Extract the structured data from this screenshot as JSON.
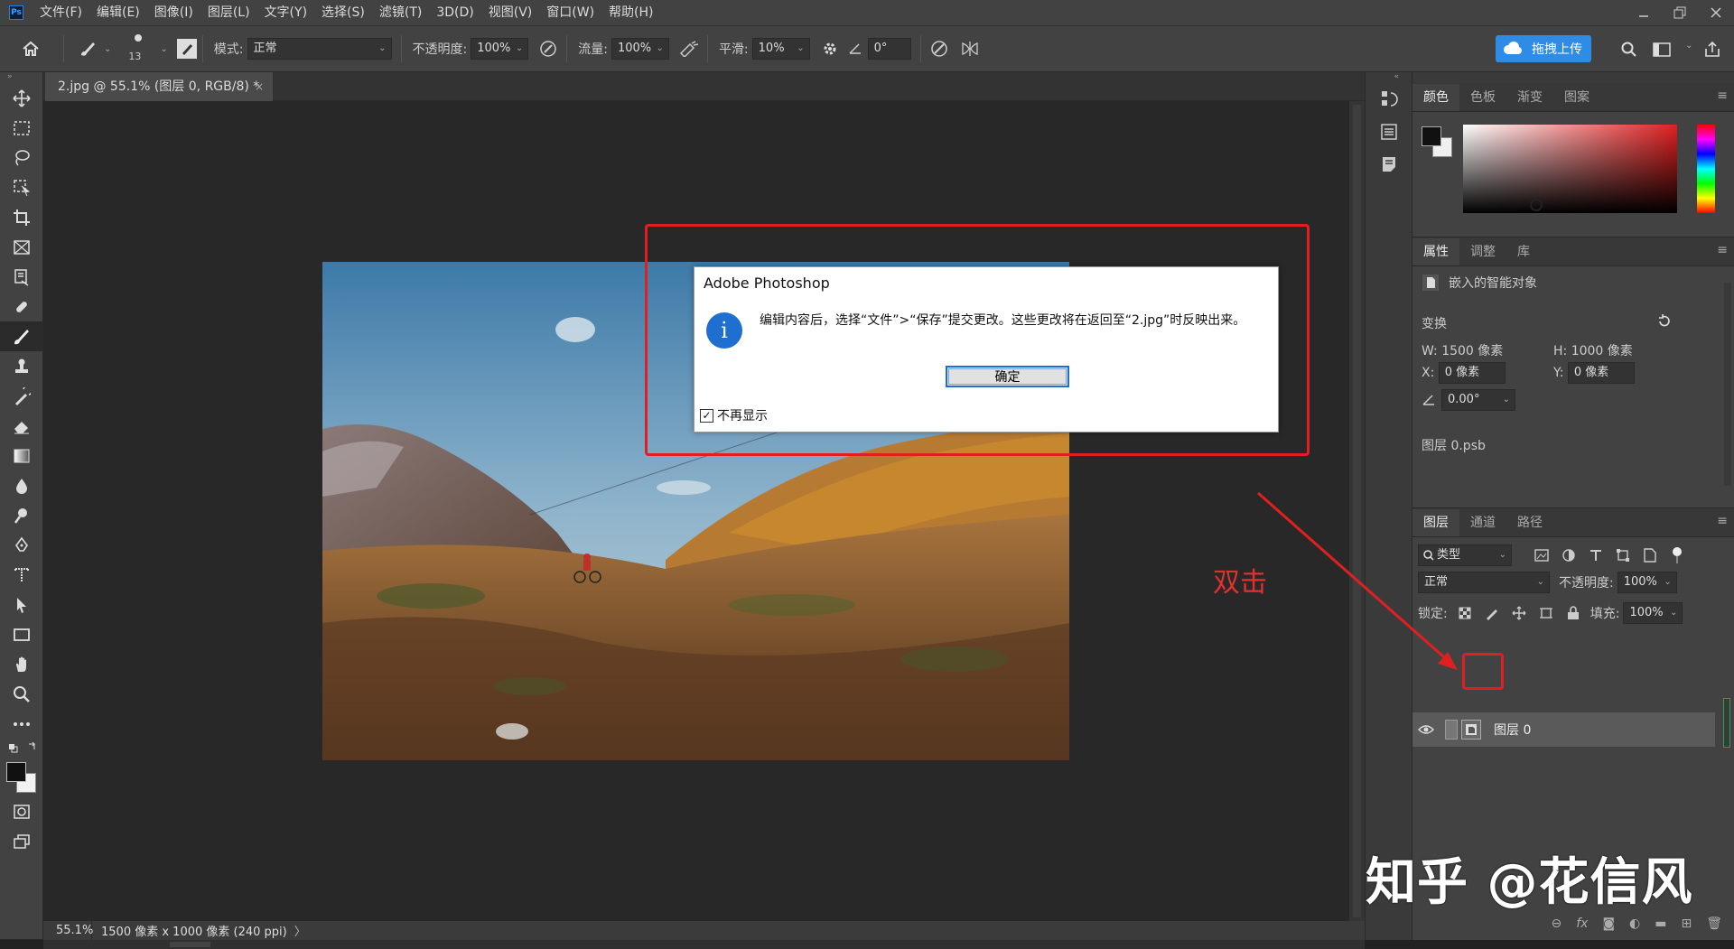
{
  "app": {
    "logo": "Ps"
  },
  "menubar": {
    "items": [
      "文件(F)",
      "编辑(E)",
      "图像(I)",
      "图层(L)",
      "文字(Y)",
      "选择(S)",
      "滤镜(T)",
      "3D(D)",
      "视图(V)",
      "窗口(W)",
      "帮助(H)"
    ],
    "window_buttons": [
      "minimize",
      "restore",
      "close"
    ]
  },
  "options": {
    "brush_size": "13",
    "mode_label": "模式:",
    "mode_value": "正常",
    "opacity_label": "不透明度:",
    "opacity_value": "100%",
    "flow_label": "流量:",
    "flow_value": "100%",
    "smooth_label": "平滑:",
    "smooth_value": "10%",
    "angle_value": "0°",
    "upload_label": "拖拽上传"
  },
  "document": {
    "tab_title": "2.jpg @ 55.1% (图层 0, RGB/8) *",
    "close": "×"
  },
  "status": {
    "zoom": "55.1%",
    "info": "1500 像素 x 1000 像素 (240 ppi)",
    "arrow": "〉"
  },
  "dialog": {
    "title": "Adobe Photoshop",
    "message": "编辑内容后，选择“文件”>“保存”提交更改。这些更改将在返回至“2.jpg”时反映出来。",
    "ok_label": "确定",
    "checkbox_label": "不再显示",
    "checkbox_checked": true,
    "info_glyph": "i"
  },
  "annotation": {
    "text": "双击",
    "color": "#e02020"
  },
  "panels": {
    "color_tabs": [
      "颜色",
      "色板",
      "渐变",
      "图案"
    ],
    "props_tabs": [
      "属性",
      "调整",
      "库"
    ],
    "props": {
      "object_type": "嵌入的智能对象",
      "transform_label": "变换",
      "w_label": "W:",
      "w_value": "1500 像素",
      "h_label": "H:",
      "h_value": "1000 像素",
      "x_label": "X:",
      "x_value": "0 像素",
      "y_label": "Y:",
      "y_value": "0 像素",
      "angle_value": "0.00°",
      "linked_file": "图层 0.psb"
    },
    "layers_tabs": [
      "图层",
      "通道",
      "路径"
    ],
    "layers": {
      "filter_value": "类型",
      "blend_mode": "正常",
      "opacity_label": "不透明度:",
      "opacity_value": "100%",
      "lock_label": "锁定:",
      "fill_label": "填充:",
      "fill_value": "100%",
      "layer_name": "图层 0"
    }
  },
  "watermark": "知乎 @花信风",
  "colors": {
    "accent": "#2e8ce6",
    "annotation_red": "#e02020",
    "panel_bg": "#424242"
  }
}
